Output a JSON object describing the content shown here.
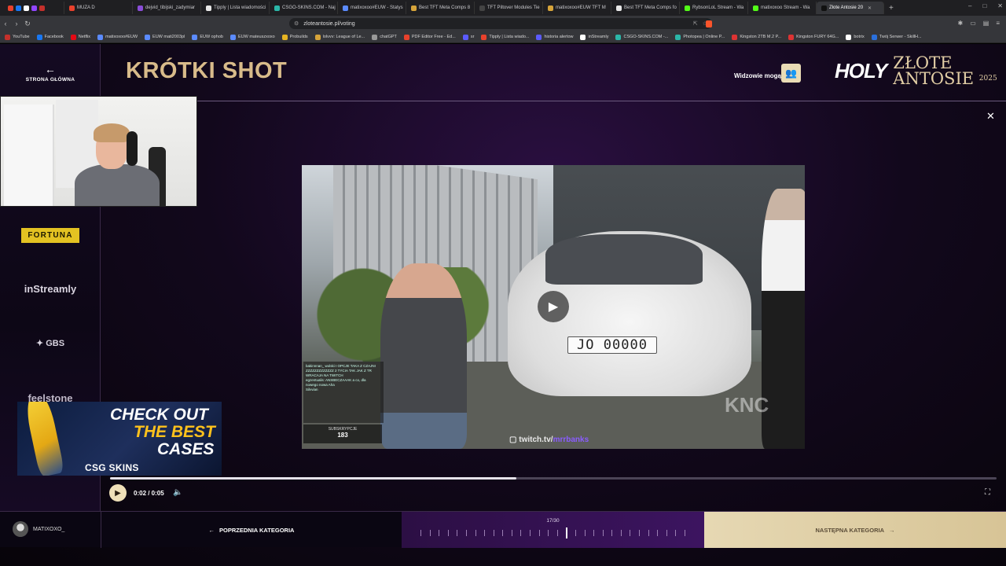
{
  "browser": {
    "tabs": [
      {
        "label": "MUZA D",
        "color": "#e8412c"
      },
      {
        "label": "dejvid_tibijski_zadymiar",
        "color": "#8a4dd8"
      },
      {
        "label": "Tipply | Lista wiadomości",
        "color": "#e8e8e8"
      },
      {
        "label": "CSGO-SKINS.COM - Naj",
        "color": "#2bb6a8"
      },
      {
        "label": "matixoxoo#EUW - Statys",
        "color": "#5b8bff"
      },
      {
        "label": "Best TFT Meta Comps 8",
        "color": "#d6a43a"
      },
      {
        "label": "TFT Piltover Modules Tie",
        "color": "#444444"
      },
      {
        "label": "matixoxoo#EUW TFT M",
        "color": "#d6a43a"
      },
      {
        "label": "Best TFT Meta Comps fo",
        "color": "#e8e8e8"
      },
      {
        "label": "RybsonLoL Stream - Wa",
        "color": "#53fc18"
      },
      {
        "label": "matixoxoo Stream - Wa",
        "color": "#53fc18"
      },
      {
        "label": "Złote Antosie 20",
        "color": "#111111"
      }
    ],
    "active_tab_index": 11,
    "url": "zloteantosie.pl/voting",
    "bookmarks": [
      "YouTube",
      "Facebook",
      "Netflix",
      "matixoxoo#EUW",
      "EUW mati2003pl",
      "EUW ophob",
      "EUW mateuszxoxo",
      "Probuilds",
      "lolvvv: League of Le...",
      "chatGPT",
      "PDF Editor Free - Ed...",
      "sr",
      "Tipply | Lista wiado...",
      "historia alertow",
      "inStreamly",
      "CSGO-SKINS.COM -...",
      "Photopea | Online P...",
      "Kingston 2TB M.2 P...",
      "Kingston FURY 64G...",
      "botrix",
      "Twój Serwer - SkillH..."
    ]
  },
  "sidebar": {
    "home_label": "STRONA GŁÓWNA",
    "sponsors": [
      "FORTUNA",
      "inStreamly",
      "GBS",
      "feelstone"
    ]
  },
  "header": {
    "title": "KRÓTKI SHOT",
    "viewers_label": "Widzowie mogą",
    "logo_holy": "HOLY",
    "logo_zlote": "ZŁOTE",
    "logo_antosie": "ANTOSIE",
    "logo_year": "2025"
  },
  "ad": {
    "line1": "CHECK OUT",
    "line2": "THE BEST",
    "line3": "CASES",
    "brand": "CSG SKINS"
  },
  "video": {
    "plate": "JO 00000",
    "watermark_prefix": "twitch.tv/",
    "watermark_name": "mrrbanks",
    "corner_mark": "KNC",
    "subs_label": "SUBSKRYPCJE",
    "subs_value": "183",
    "chat_lines": [
      "bakinnnan_ wolski I OPCJE TAKA Z CZAJNI",
      "ZZZZZZZZZZZZZ 2 TYCIA TAK JAK Z TR",
      "WRACAJA NA TWITCH",
      "egzentualis: ANSBECZAAAK a co, dla",
      "nowego nowa Aha",
      "Silvvian"
    ]
  },
  "player": {
    "time": "0:02 / 0:05",
    "progress": 0.458
  },
  "footer": {
    "username": "MATIXOXO_",
    "prev_label": "POPRZEDNIA KATEGORIA",
    "counter": "17/30",
    "current": 17,
    "total": 30,
    "next_label": "NASTĘPNA KATEGORIA"
  }
}
